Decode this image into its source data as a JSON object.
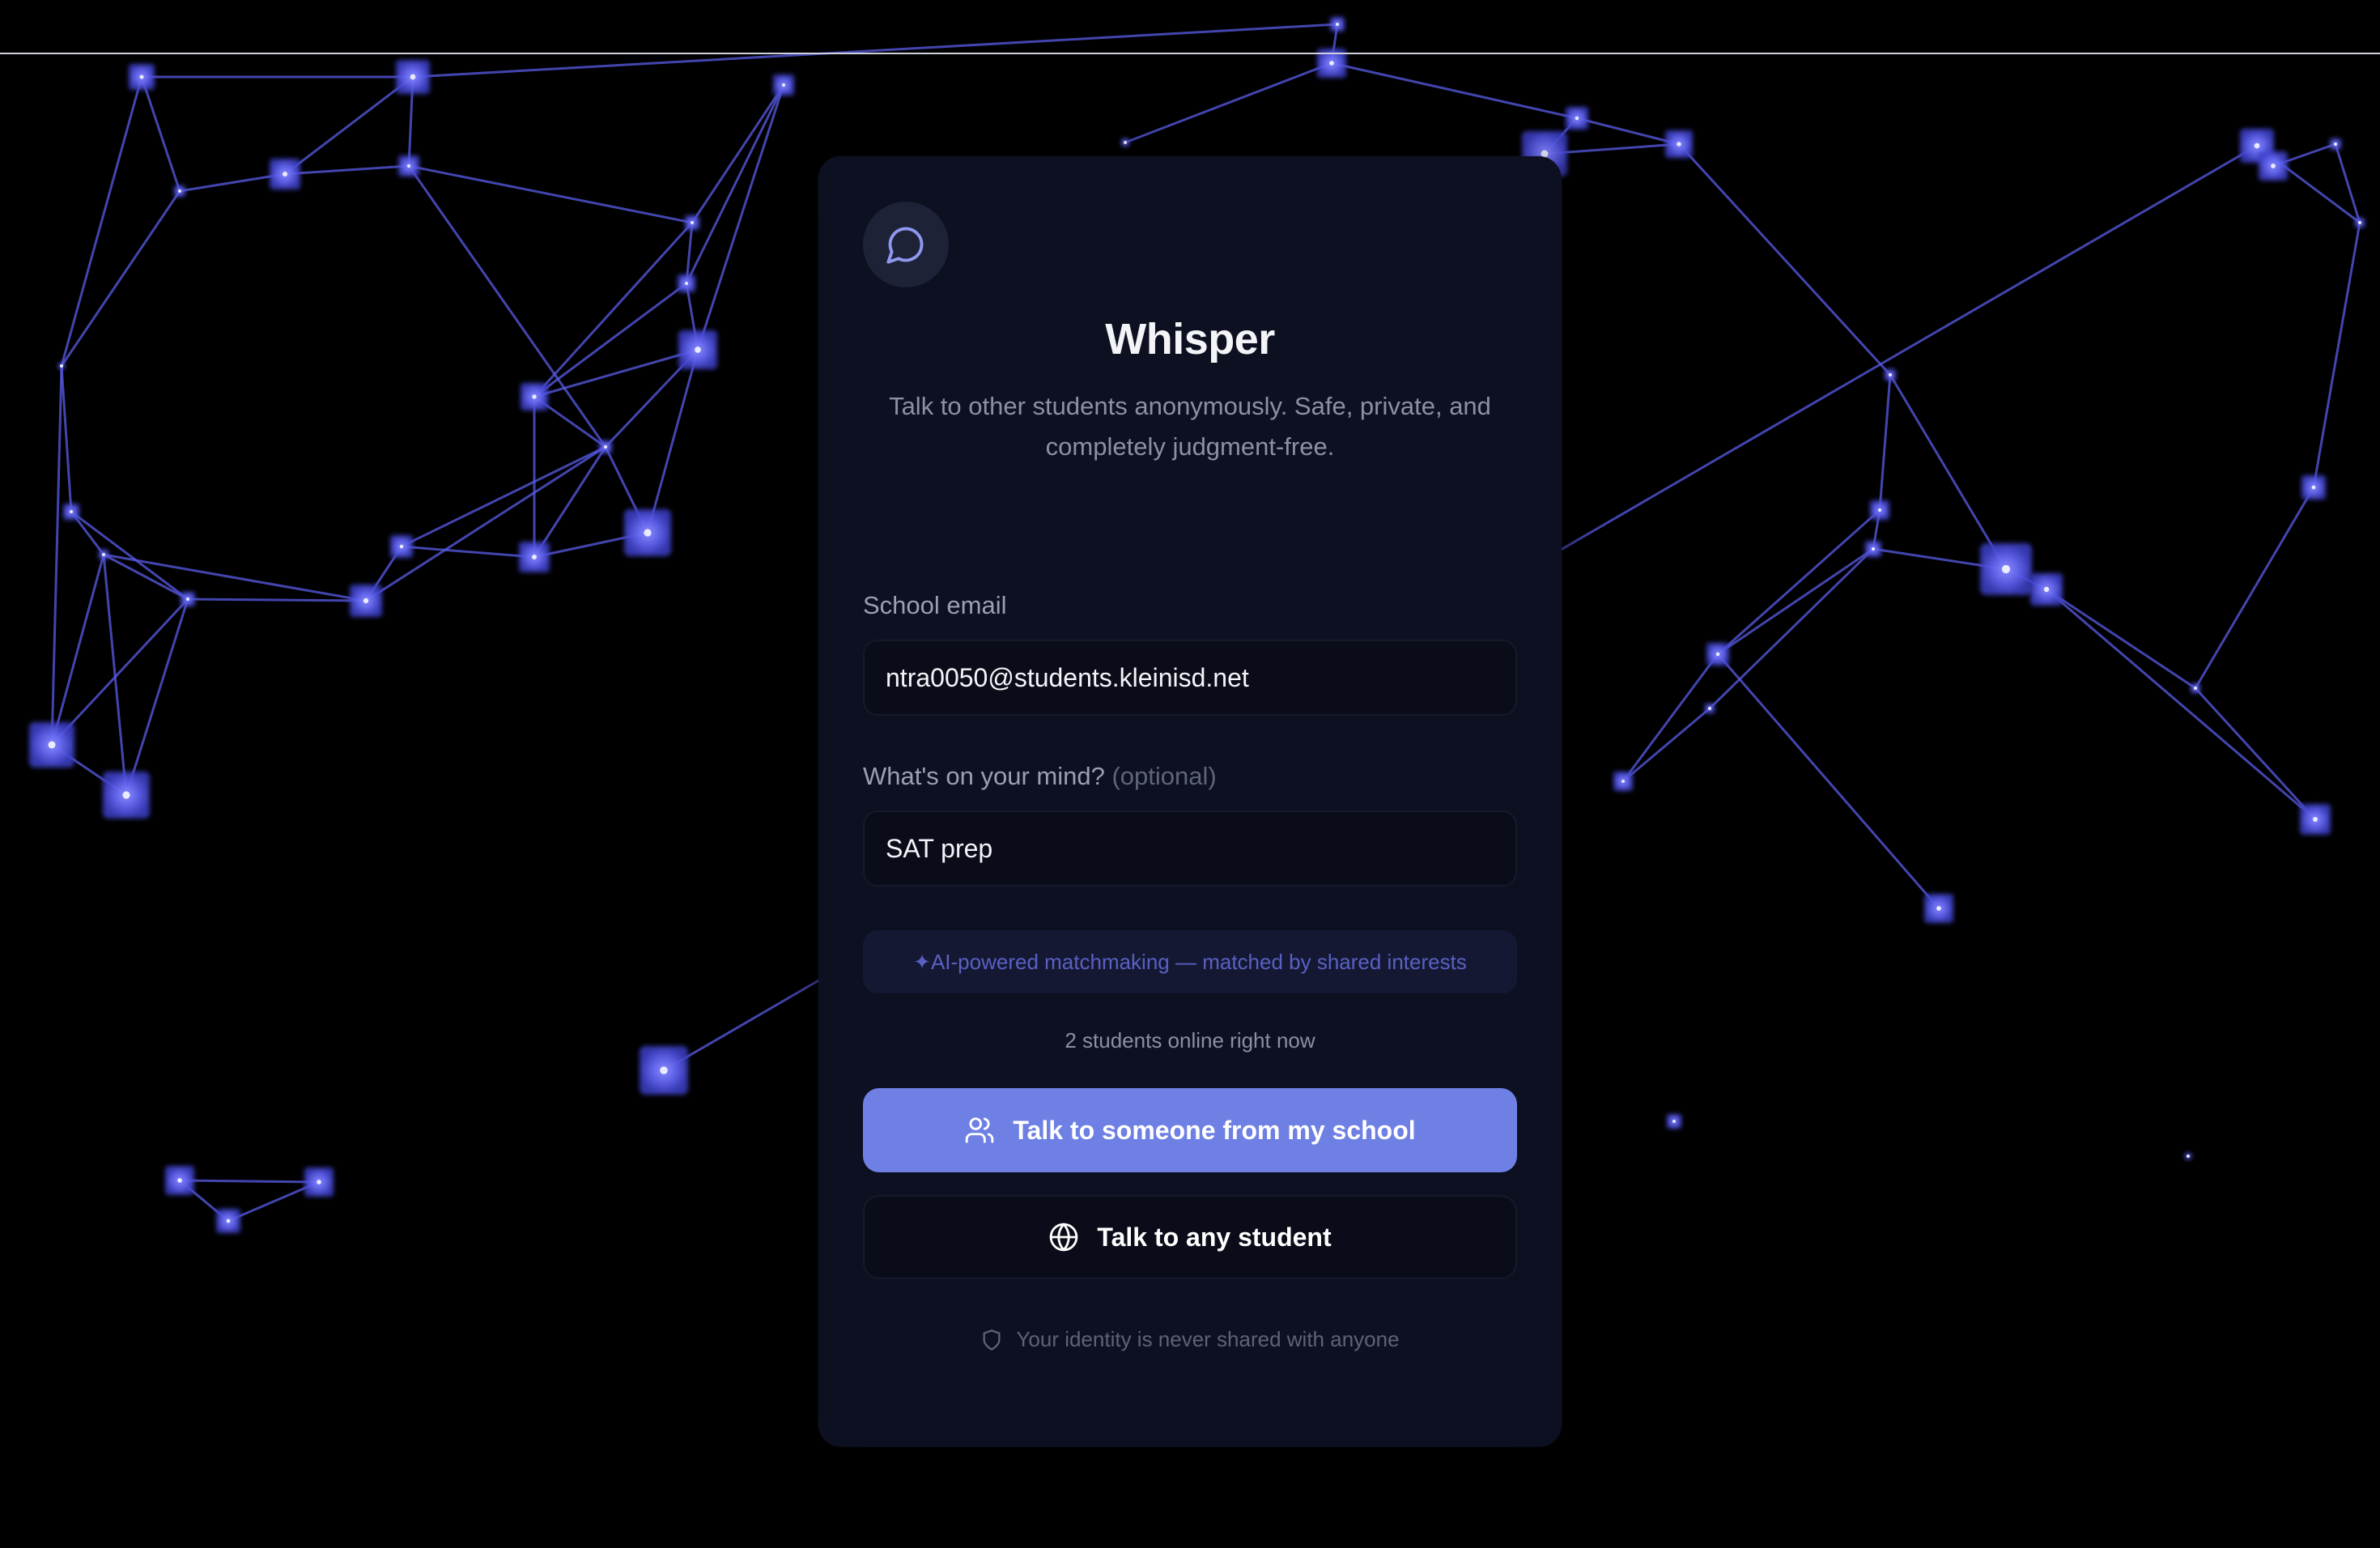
{
  "colors": {
    "background": "#000000",
    "card": "#0d1020",
    "accent": "#6f80e5",
    "node": "#6a6cf4"
  },
  "brand": {
    "logo_icon": "chat-bubble-icon",
    "title": "Whisper",
    "subtitle": "Talk to other students anonymously. Safe, private, and completely judgment-free."
  },
  "form": {
    "email_label": "School email",
    "email_value": "ntra0050@students.kleinisd.net",
    "mind_label": "What's on your mind?",
    "mind_optional": "(optional)",
    "mind_value": "SAT prep"
  },
  "ai_note": "✦AI-powered matchmaking — matched by shared interests",
  "online_status": "2 students online right now",
  "buttons": {
    "school_label": "Talk to someone from my school",
    "school_icon": "users-icon",
    "any_label": "Talk to any student",
    "any_icon": "globe-icon"
  },
  "privacy": {
    "icon": "shield-icon",
    "text": "Your identity is never shared with anyone"
  }
}
